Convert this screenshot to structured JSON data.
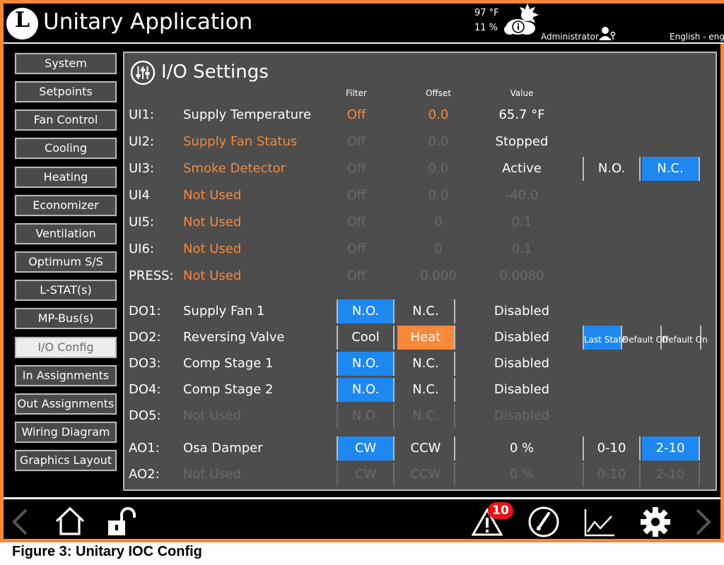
{
  "header": {
    "logo_letter": "L",
    "title": "Unitary Application",
    "temperature": "97 °F",
    "humidity": "11 %",
    "user": "Administrator",
    "language": "English - eng"
  },
  "nav": [
    {
      "label": "System"
    },
    {
      "label": "Setpoints"
    },
    {
      "label": "Fan Control"
    },
    {
      "label": "Cooling"
    },
    {
      "label": "Heating"
    },
    {
      "label": "Economizer"
    },
    {
      "label": "Ventilation"
    },
    {
      "label": "Optimum S/S"
    },
    {
      "label": "L-STAT(s)"
    },
    {
      "label": "MP-Bus(s)"
    },
    {
      "label": "I/O Config",
      "active": true
    },
    {
      "label": "In Assignments"
    },
    {
      "label": "Out Assignments"
    },
    {
      "label": "Wiring Diagram"
    },
    {
      "label": "Graphics Layout"
    }
  ],
  "panel": {
    "title": "I/O Settings",
    "headers": {
      "filter": "Filter",
      "offset": "Offset",
      "value": "Value"
    }
  },
  "inputs": [
    {
      "id": "UI1:",
      "label": "Supply Temperature",
      "filter": "Off",
      "offset": "0.0",
      "value": "65.7 °F"
    },
    {
      "id": "UI2:",
      "label": "Supply Fan Status",
      "filter": "Off",
      "offset": "0.0",
      "value": "Stopped"
    },
    {
      "id": "UI3:",
      "label": "Smoke Detector",
      "filter": "Off",
      "offset": "0.0",
      "value": "Active",
      "opt1": "N.O.",
      "opt2": "N.C."
    },
    {
      "id": "UI4",
      "label": "Not Used",
      "filter": "Off",
      "offset": "0.0",
      "value": "-40.0"
    },
    {
      "id": "UI5:",
      "label": "Not Used",
      "filter": "Off",
      "offset": "0",
      "value": "0.1"
    },
    {
      "id": "UI6:",
      "label": "Not Used",
      "filter": "Off",
      "offset": "0",
      "value": "0.1"
    },
    {
      "id": "PRESS:",
      "label": "Not Used",
      "filter": "Off",
      "offset": "0.000",
      "value": "0.0080"
    }
  ],
  "outputs": [
    {
      "id": "DO1:",
      "label": "Supply Fan 1",
      "opt1": "N.O.",
      "opt2": "N.C.",
      "value": "Disabled"
    },
    {
      "id": "DO2:",
      "label": "Reversing Valve",
      "opt1": "Cool",
      "opt2": "Heat",
      "value": "Disabled",
      "fail": [
        "Last State",
        "Default Off",
        "Default On"
      ]
    },
    {
      "id": "DO3:",
      "label": "Comp Stage 1",
      "opt1": "N.O.",
      "opt2": "N.C.",
      "value": "Disabled"
    },
    {
      "id": "DO4:",
      "label": "Comp Stage 2",
      "opt1": "N.O.",
      "opt2": "N.C.",
      "value": "Disabled"
    },
    {
      "id": "DO5:",
      "label": "Not Used",
      "opt1": "N.O.",
      "opt2": "N.C.",
      "value": "Disabled"
    },
    {
      "id": "AO1:",
      "label": "Osa Damper",
      "opt1": "CW",
      "opt2": "CCW",
      "value": "0 %",
      "range1": "0-10",
      "range2": "2-10"
    },
    {
      "id": "AO2:",
      "label": "Not Used",
      "opt1": "CW",
      "opt2": "CCW",
      "value": "0 %",
      "range1": "0-10",
      "range2": "2-10"
    }
  ],
  "footer": {
    "alarm_count": "10"
  },
  "caption": "Figure 3: Unitary IOC Config",
  "colors": {
    "accent": "#f7883a",
    "selected": "#1e88f0",
    "panel": "#4d4d4d",
    "alarm": "#e8141a"
  }
}
